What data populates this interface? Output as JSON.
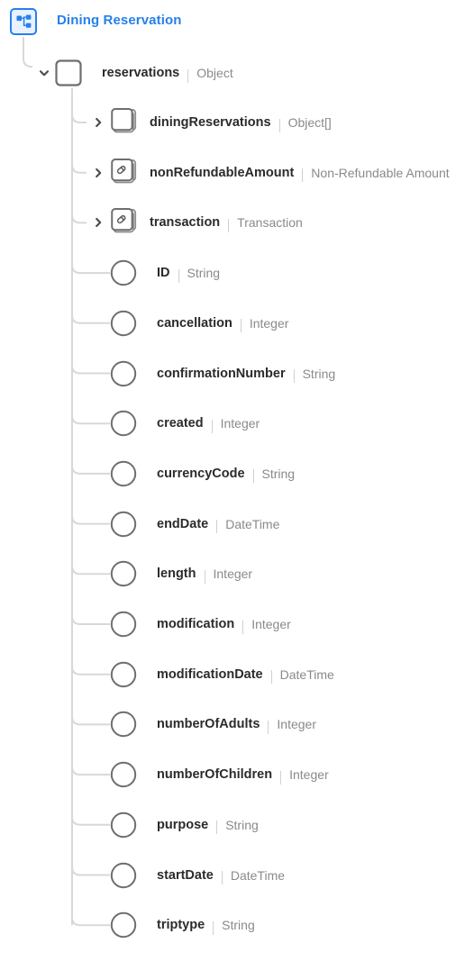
{
  "header": {
    "icon": "hierarchy-icon",
    "title": "Dining Reservation",
    "accent_color": "#2680eb"
  },
  "tree": {
    "root": {
      "icon": "square-node-icon",
      "expander": "chevron-down-icon",
      "expanded": true,
      "name": "reservations",
      "type": "Object"
    },
    "branches": [
      {
        "icon": "stacked-squares-icon",
        "expander": "chevron-right-icon",
        "expanded": false,
        "name": "diningReservations",
        "type": "Object[]"
      },
      {
        "icon": "stacked-squares-link-icon",
        "expander": "chevron-right-icon",
        "expanded": false,
        "name": "nonRefundableAmount",
        "type": "Non-Refundable Amount"
      },
      {
        "icon": "stacked-squares-link-icon",
        "expander": "chevron-right-icon",
        "expanded": false,
        "name": "transaction",
        "type": "Transaction"
      }
    ],
    "leaves": [
      {
        "icon": "circle-node-icon",
        "name": "ID",
        "type": "String"
      },
      {
        "icon": "circle-node-icon",
        "name": "cancellation",
        "type": "Integer"
      },
      {
        "icon": "circle-node-icon",
        "name": "confirmationNumber",
        "type": "String"
      },
      {
        "icon": "circle-node-icon",
        "name": "created",
        "type": "Integer"
      },
      {
        "icon": "circle-node-icon",
        "name": "currencyCode",
        "type": "String"
      },
      {
        "icon": "circle-node-icon",
        "name": "endDate",
        "type": "DateTime"
      },
      {
        "icon": "circle-node-icon",
        "name": "length",
        "type": "Integer"
      },
      {
        "icon": "circle-node-icon",
        "name": "modification",
        "type": "Integer"
      },
      {
        "icon": "circle-node-icon",
        "name": "modificationDate",
        "type": "DateTime"
      },
      {
        "icon": "circle-node-icon",
        "name": "numberOfAdults",
        "type": "Integer"
      },
      {
        "icon": "circle-node-icon",
        "name": "numberOfChildren",
        "type": "Integer"
      },
      {
        "icon": "circle-node-icon",
        "name": "purpose",
        "type": "String"
      },
      {
        "icon": "circle-node-icon",
        "name": "startDate",
        "type": "DateTime"
      },
      {
        "icon": "circle-node-icon",
        "name": "triptype",
        "type": "String"
      }
    ],
    "colors": {
      "connector": "#d8d8d8",
      "node_stroke": "#6e6e6e",
      "label": "#2b2b2b",
      "type": "#8a8a8a"
    }
  }
}
